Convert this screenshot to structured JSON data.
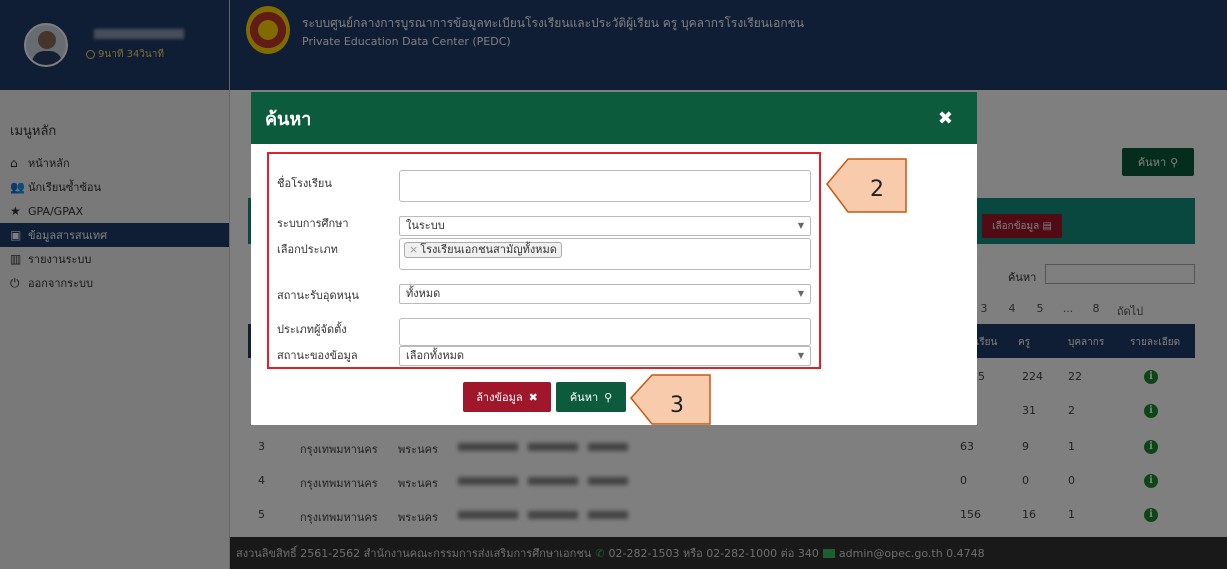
{
  "sidebar": {
    "time_text": "9นาที 34วินาที",
    "menu_title": "เมนูหลัก",
    "items": [
      {
        "icon": "⌂",
        "label": "หน้าหลัก"
      },
      {
        "icon": "👥",
        "label": "นักเรียนซ้ำซ้อน"
      },
      {
        "icon": "★",
        "label": "GPA/GPAX"
      },
      {
        "icon": "▣",
        "label": "ข้อมูลสารสนเทศ"
      },
      {
        "icon": "▥",
        "label": "รายงานระบบ"
      },
      {
        "icon": "⏻",
        "label": "ออกจากระบบ"
      }
    ]
  },
  "header": {
    "title_th": "ระบบศูนย์กลางการบูรณาการข้อมูลทะเบียนโรงเรียนและประวัติผู้เรียน ครู บุคลากรโรงเรียนเอกชน",
    "title_en": "Private Education Data Center (PEDC)"
  },
  "main": {
    "search_button": "ค้นหา",
    "select_data_button": "เลือกข้อมูล",
    "search_label": "ค้นหา",
    "pager": [
      "3",
      "4",
      "5",
      "...",
      "8",
      "ถัดไป"
    ],
    "columns": {
      "students": "ผู้เรียน",
      "teachers": "ครู",
      "staff": "บุคลากร",
      "details": "รายละเอียด"
    },
    "rows": [
      {
        "no": "",
        "province": "",
        "district": "",
        "students": "5",
        "teachers": "224",
        "staff": "22"
      },
      {
        "no": "",
        "province": "",
        "district": "",
        "students": "",
        "teachers": "31",
        "staff": "2"
      },
      {
        "no": "3",
        "province": "กรุงเทพมหานคร",
        "district": "พระนคร",
        "students": "63",
        "teachers": "9",
        "staff": "1"
      },
      {
        "no": "4",
        "province": "กรุงเทพมหานคร",
        "district": "พระนคร",
        "students": "0",
        "teachers": "0",
        "staff": "0"
      },
      {
        "no": "5",
        "province": "กรุงเทพมหานคร",
        "district": "พระนคร",
        "students": "156",
        "teachers": "16",
        "staff": "1"
      }
    ]
  },
  "footer": {
    "copyright": "สงวนลิขสิทธิ์ 2561-2562 สำนักงานคณะกรรมการส่งเสริมการศึกษาเอกชน",
    "phone": "02-282-1503 หรือ 02-282-1000 ต่อ 340",
    "email": "admin@opec.go.th 0.4748"
  },
  "modal": {
    "title": "ค้นหา",
    "fields": {
      "school_name_label": "ชื่อโรงเรียน",
      "school_name_value": "",
      "edu_system_label": "ระบบการศึกษา",
      "edu_system_value": "ในระบบ",
      "type_label": "เลือกประเภท",
      "type_tag": "โรงเรียนเอกชนสามัญทั้งหมด",
      "subsidy_label": "สถานะรับอุดหนุน",
      "subsidy_value": "ทั้งหมด",
      "founder_label": "ประเภทผู้จัดตั้ง",
      "founder_value": "",
      "data_status_label": "สถานะของข้อมูล",
      "data_status_value": "เลือกทั้งหมด"
    },
    "clear_button": "ล้างข้อมูล",
    "search_button": "ค้นหา"
  },
  "callouts": {
    "form": "2",
    "button": "3"
  },
  "colors": {
    "primary_blue": "#1f3b6b",
    "primary_green": "#0b5b3c",
    "danger_red": "#a0162a",
    "callout_fill": "#f8cbad",
    "highlight_border": "#e0202a"
  }
}
